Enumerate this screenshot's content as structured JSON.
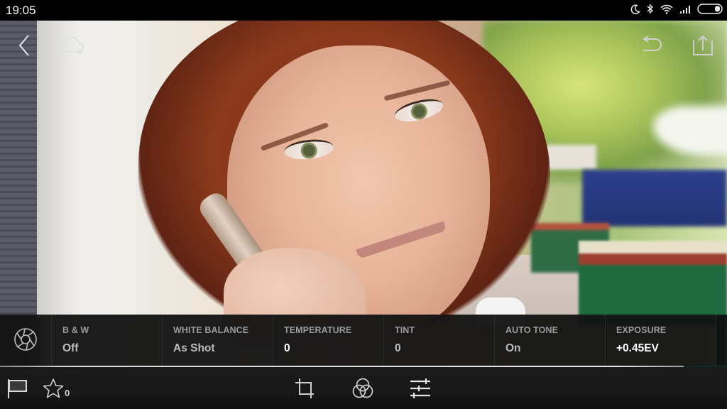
{
  "status_bar": {
    "time": "19:05",
    "icons": [
      "moon-icon",
      "bluetooth-icon",
      "wifi-icon",
      "signal-icon",
      "battery-icon"
    ]
  },
  "top_bar": {
    "left": [
      {
        "name": "back-button",
        "icon": "chevron-left-icon"
      },
      {
        "name": "cloud-sync-button",
        "icon": "cloud-off-icon"
      }
    ],
    "right": [
      {
        "name": "undo-button",
        "icon": "undo-icon"
      },
      {
        "name": "share-button",
        "icon": "share-icon"
      }
    ]
  },
  "settings": {
    "preset_icon": "aperture-icon",
    "items": [
      {
        "label": "B & W",
        "value": "Off"
      },
      {
        "label": "WHITE BALANCE",
        "value": "As Shot"
      },
      {
        "label": "TEMPERATURE",
        "value": "0"
      },
      {
        "label": "TINT",
        "value": "0"
      },
      {
        "label": "AUTO TONE",
        "value": "On"
      },
      {
        "label": "EXPOSURE",
        "value": "+0.45EV"
      }
    ]
  },
  "progress": {
    "fraction": 0.94
  },
  "toolbar": {
    "flag": {
      "icon": "flag-icon"
    },
    "rating": {
      "icon": "star-icon",
      "count": "0"
    },
    "tools": [
      {
        "name": "crop-tool",
        "icon": "crop-icon"
      },
      {
        "name": "presets-tool",
        "icon": "color-circles-icon"
      },
      {
        "name": "adjust-tool",
        "icon": "sliders-icon"
      }
    ]
  },
  "colors": {
    "panel_bg": "#141414",
    "label_text": "#9c9c9c",
    "value_text": "#bdbdbd",
    "active_value_text": "#ffffff",
    "progress_fill": "#e8e8e8",
    "status_bar_bg": "#000000"
  }
}
